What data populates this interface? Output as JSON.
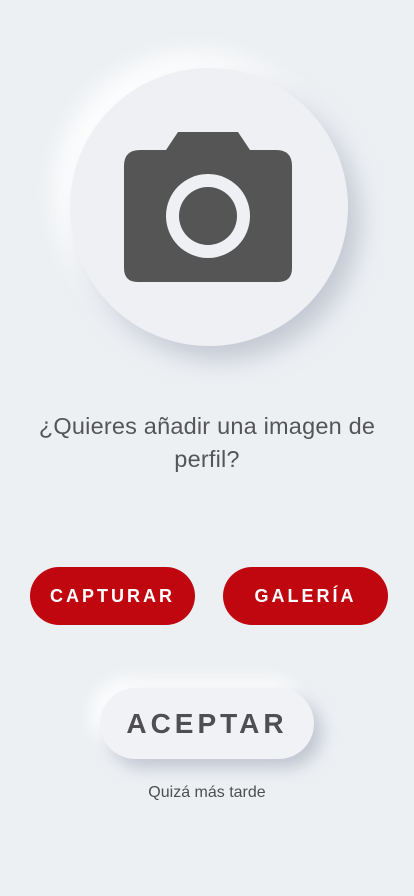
{
  "avatar": {
    "icon": "camera-icon",
    "icon_color": "#555555"
  },
  "prompt": {
    "text": "¿Quieres añadir una imagen de perfil?"
  },
  "actions": {
    "capture_label": "CAPTURAR",
    "gallery_label": "GALERÍA",
    "accept_label": "ACEPTAR",
    "later_label": "Quizá más tarde"
  },
  "colors": {
    "background": "#edf0f3",
    "accent": "#c0060f",
    "text": "#555559"
  }
}
